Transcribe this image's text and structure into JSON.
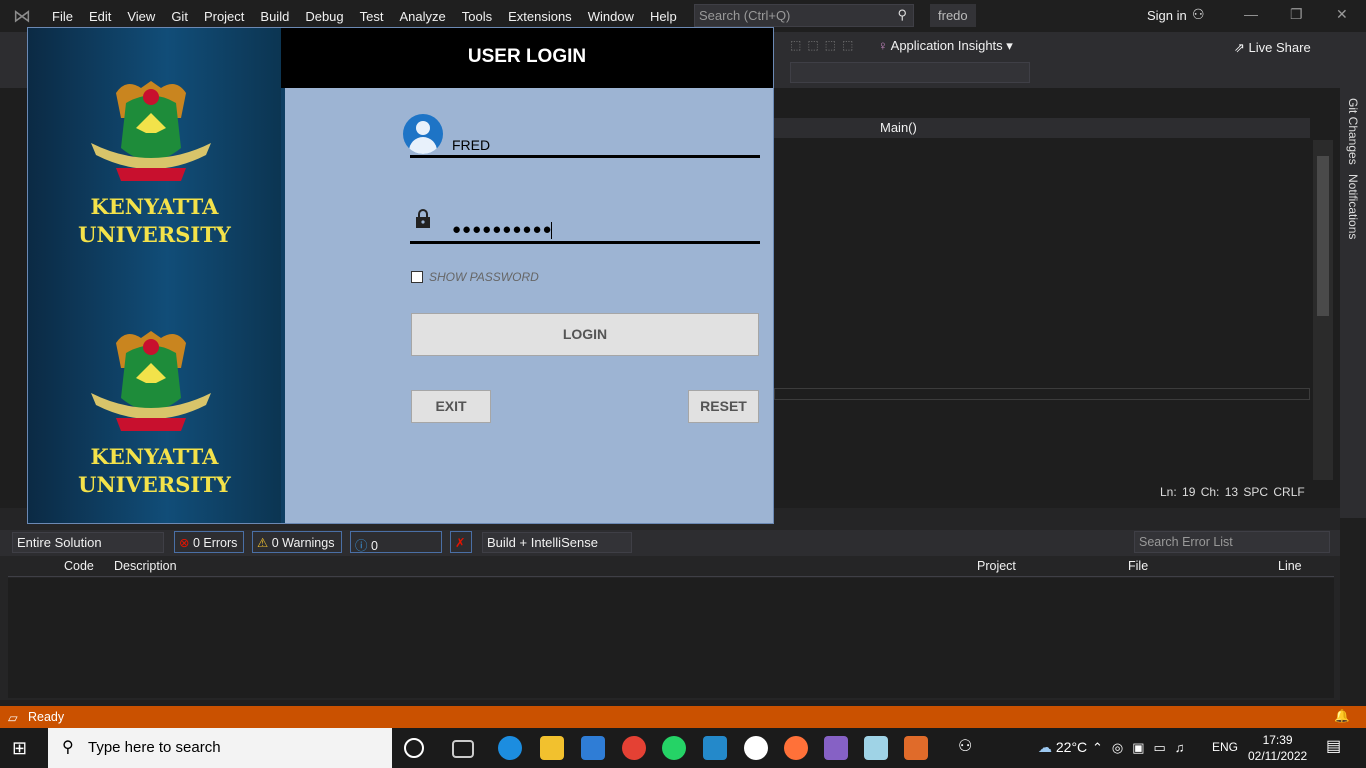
{
  "vs": {
    "menu": [
      "File",
      "Edit",
      "View",
      "Git",
      "Project",
      "Build",
      "Debug",
      "Test",
      "Analyze",
      "Tools",
      "Extensions",
      "Window",
      "Help"
    ],
    "search_placeholder": "Search (Ctrl+Q)",
    "solution_name": "fredo",
    "sign_in": "Sign in",
    "app_insights": "Application Insights",
    "live_share": "Live Share",
    "nav_method": "Main()",
    "cursor_status": "Ln: 19    Ch: 13    SPC    CRLF",
    "side_tabs": [
      "Git Changes",
      "Notifications"
    ],
    "status": "Ready"
  },
  "error_list": {
    "scope": "Entire Solution",
    "errors": "0 Errors",
    "warnings": "0 Warnings",
    "messages": "0 Messages",
    "build_filter": "Build + IntelliSense",
    "search_placeholder": "Search Error List",
    "columns": [
      "Code",
      "Description",
      "Project",
      "File",
      "Line"
    ]
  },
  "login": {
    "title": "USER LOGIN",
    "university_line1": "KENYATTA",
    "university_line2": "UNIVERSITY",
    "username": "FRED",
    "password_masked": "●●●●●●●●●●",
    "show_password_label": "SHOW PASSWORD",
    "show_password_checked": false,
    "login_button": "LOGIN",
    "exit_button": "EXIT",
    "reset_button": "RESET"
  },
  "taskbar": {
    "search_placeholder": "Type here to search",
    "weather": "22°C",
    "language": "ENG",
    "time": "17:39",
    "date": "02/11/2022"
  }
}
